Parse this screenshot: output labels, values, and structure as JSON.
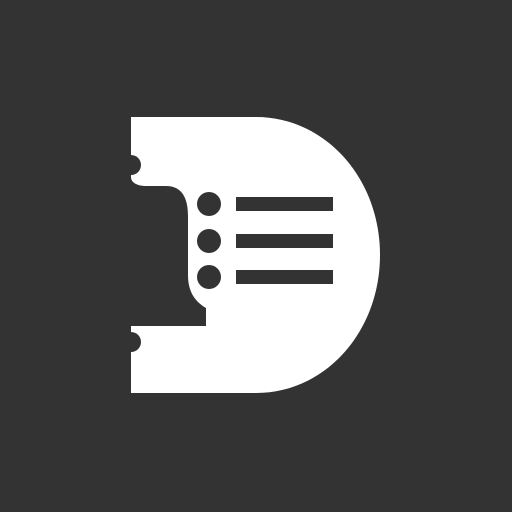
{
  "icon": {
    "name": "d-logo-with-bell-and-list",
    "colors": {
      "background": "#333333",
      "glyph": "#ffffff",
      "cutout": "#333333"
    },
    "list_items": 3
  }
}
